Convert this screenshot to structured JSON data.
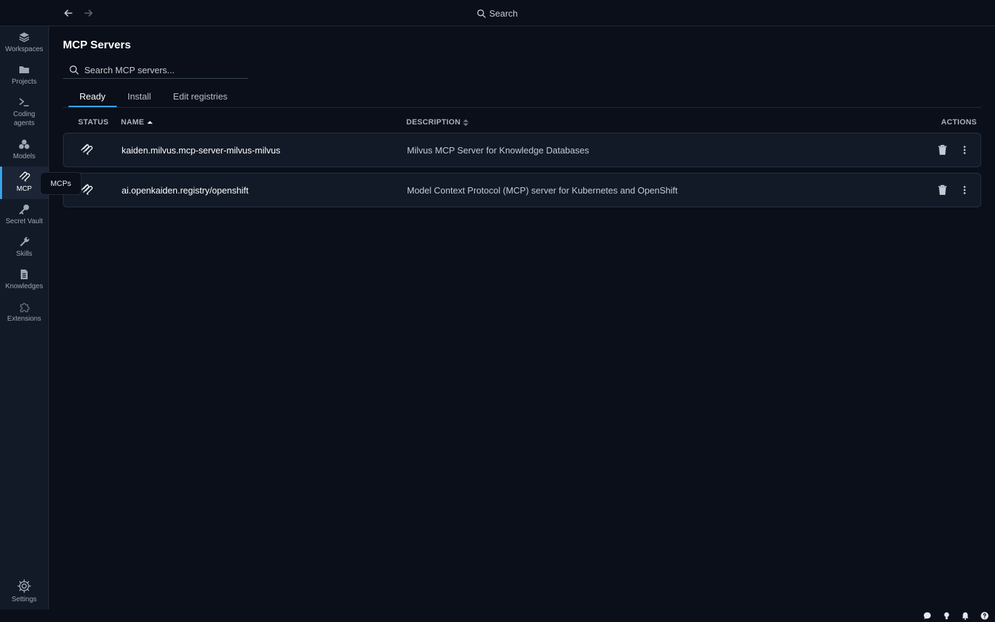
{
  "topbar": {
    "back_icon": "arrow-left-icon",
    "forward_icon": "arrow-right-icon",
    "search_label": "Search"
  },
  "sidebar": {
    "items": [
      {
        "label": "Workspaces",
        "icon": "layers-icon"
      },
      {
        "label": "Projects",
        "icon": "folder-icon"
      },
      {
        "label": "Coding agents",
        "icon": "terminal-icon"
      },
      {
        "label": "Models",
        "icon": "cubes-icon"
      },
      {
        "label": "MCP",
        "icon": "mcp-icon",
        "active": true
      },
      {
        "label": "Secret Vault",
        "icon": "key-icon"
      },
      {
        "label": "Skills",
        "icon": "wrench-icon"
      },
      {
        "label": "Knowledges",
        "icon": "document-icon"
      },
      {
        "label": "Extensions",
        "icon": "puzzle-icon"
      }
    ],
    "settings_label": "Settings",
    "tooltip": "MCPs"
  },
  "main": {
    "title": "MCP Servers",
    "search_placeholder": "Search MCP servers...",
    "tabs": [
      {
        "label": "Ready",
        "active": true
      },
      {
        "label": "Install"
      },
      {
        "label": "Edit registries"
      }
    ],
    "columns": {
      "status": "STATUS",
      "name": "NAME",
      "description": "DESCRIPTION",
      "actions": "ACTIONS"
    },
    "rows": [
      {
        "name": "kaiden.milvus.mcp-server-milvus-milvus",
        "description": "Milvus MCP Server for Knowledge Databases"
      },
      {
        "name": "ai.openkaiden.registry/openshift",
        "description": "Model Context Protocol (MCP) server for Kubernetes and OpenShift"
      }
    ]
  },
  "statusbar": {
    "icons": [
      "chat-icon",
      "lightbulb-icon",
      "bell-icon",
      "help-icon"
    ]
  },
  "colors": {
    "background": "#0a0f19",
    "sidebar": "#121a28",
    "accent": "#3aa4ee",
    "row_bg": "#121a28"
  }
}
